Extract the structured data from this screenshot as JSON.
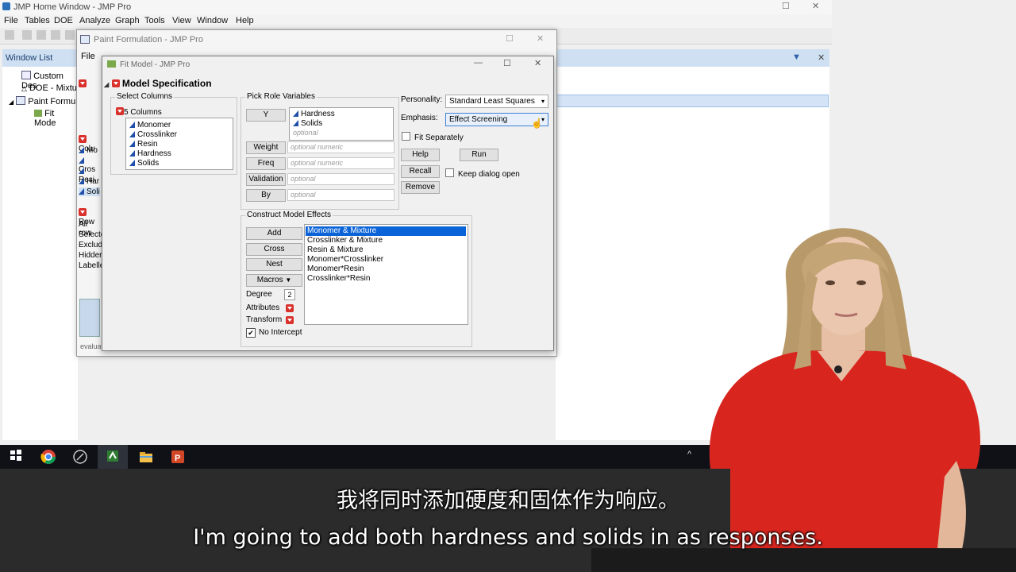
{
  "main_window": {
    "title": "JMP Home Window - JMP Pro",
    "menus": [
      "File",
      "Tables",
      "DOE",
      "Analyze",
      "Graph",
      "Tools",
      "View",
      "Window",
      "Help"
    ]
  },
  "window_list": {
    "header": "Window List",
    "items": [
      "Custom Des",
      "DOE - Mixtu",
      "Paint Formu",
      "Fit Mode"
    ]
  },
  "paint_window": {
    "title": "Paint Formulation - JMP Pro",
    "menu_first": "File",
    "left_items": [
      "Colu",
      "Mo",
      "Cros",
      "Resi",
      "Har",
      "Soli",
      "Row",
      "All row",
      "Selecte",
      "Exclud",
      "Hidder",
      "Labelle"
    ],
    "status": "evaluations done"
  },
  "fit_model": {
    "title": "Fit Model - JMP Pro",
    "header": "Model Specification",
    "select_columns": {
      "title": "Select Columns",
      "count_label": "5 Columns",
      "columns": [
        "Monomer",
        "Crosslinker",
        "Resin",
        "Hardness",
        "Solids"
      ]
    },
    "pick_roles": {
      "title": "Pick Role Variables",
      "y_label": "Y",
      "y_values": [
        "Hardness",
        "Solids"
      ],
      "y_placeholder": "optional",
      "roles": [
        {
          "label": "Weight",
          "placeholder": "optional numeric"
        },
        {
          "label": "Freq",
          "placeholder": "optional numeric"
        },
        {
          "label": "Validation",
          "placeholder": "optional"
        },
        {
          "label": "By",
          "placeholder": "optional"
        }
      ]
    },
    "personality_label": "Personality:",
    "personality_value": "Standard Least Squares",
    "emphasis_label": "Emphasis:",
    "emphasis_value": "Effect Screening",
    "fit_separately_label": "Fit Separately",
    "fit_separately_checked": false,
    "buttons": {
      "help": "Help",
      "run": "Run",
      "recall": "Recall",
      "remove": "Remove"
    },
    "keep_dialog_open_label": "Keep dialog open",
    "keep_dialog_open_checked": false,
    "construct": {
      "title": "Construct Model Effects",
      "add": "Add",
      "cross": "Cross",
      "nest": "Nest",
      "macros": "Macros",
      "degree_label": "Degree",
      "degree_value": "2",
      "attributes_label": "Attributes",
      "transform_label": "Transform",
      "no_intercept_label": "No Intercept",
      "no_intercept_checked": true,
      "effects": [
        "Monomer & Mixture",
        "Crosslinker & Mixture",
        "Resin & Mixture",
        "Monomer*Crosslinker",
        "Monomer*Resin",
        "Crosslinker*Resin"
      ],
      "selected_index": 0
    }
  },
  "subtitles": {
    "chinese": "我将同时添加硬度和固体作为响应。",
    "english": "I'm going to add both hardness and solids in as responses."
  }
}
